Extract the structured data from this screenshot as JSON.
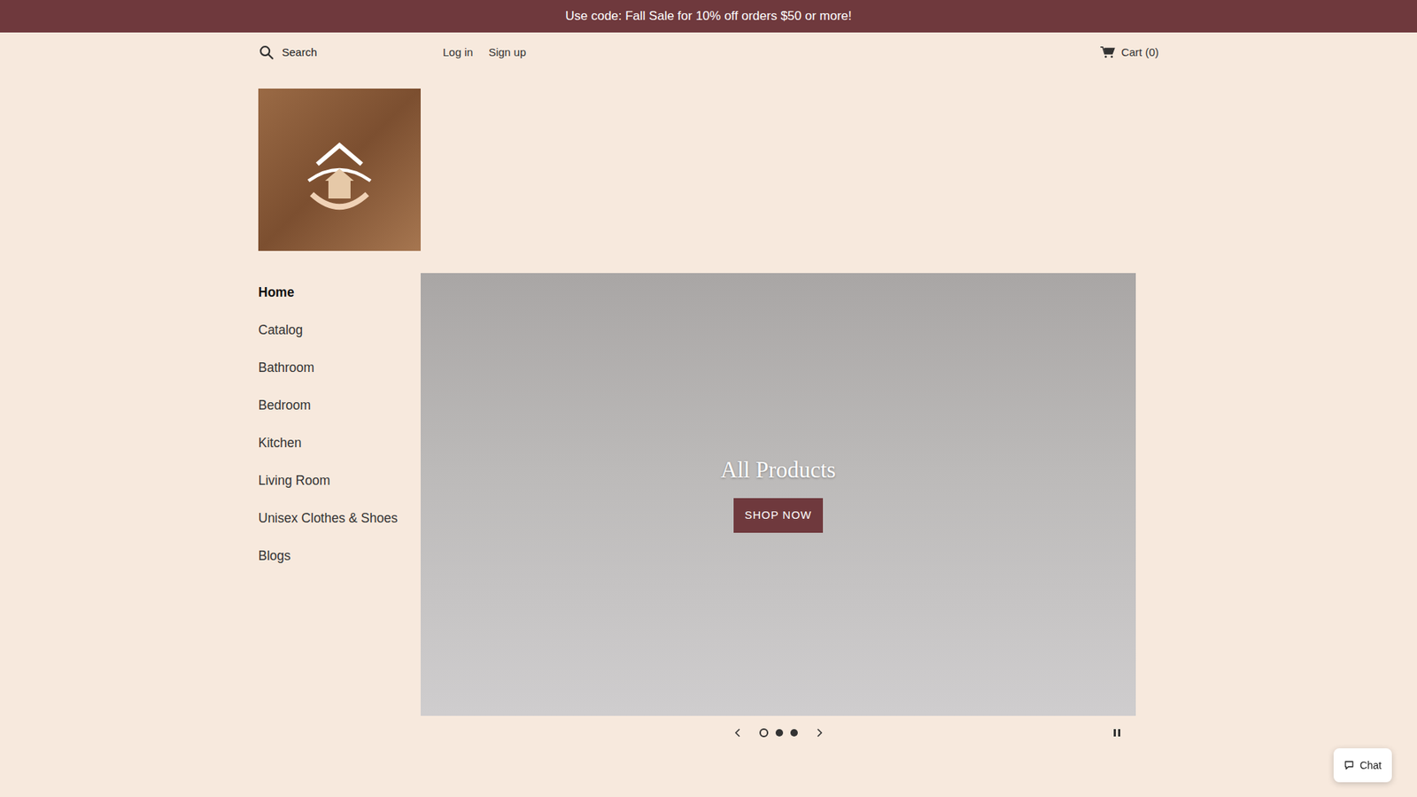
{
  "announcement": "Use code: Fall Sale for 10% off orders $50 or more!",
  "search": {
    "placeholder": "Search"
  },
  "account_links": [
    "Log in",
    "Sign up"
  ],
  "cart": {
    "label": "Cart (0)"
  },
  "sidebar": {
    "items": [
      {
        "label": "Home",
        "selected": true
      },
      {
        "label": "Catalog",
        "selected": false
      },
      {
        "label": "Bathroom",
        "selected": false
      },
      {
        "label": "Bedroom",
        "selected": false
      },
      {
        "label": "Kitchen",
        "selected": false
      },
      {
        "label": "Living Room",
        "selected": false
      },
      {
        "label": "Unisex Clothes & Shoes",
        "selected": false
      },
      {
        "label": "Blogs",
        "selected": false
      }
    ]
  },
  "slideshow": {
    "title": "All Products",
    "button": "SHOP NOW",
    "slides": [
      {
        "selected": true
      },
      {
        "selected": false
      },
      {
        "selected": false
      }
    ],
    "paused": false
  },
  "chat": {
    "label": "Chat"
  }
}
